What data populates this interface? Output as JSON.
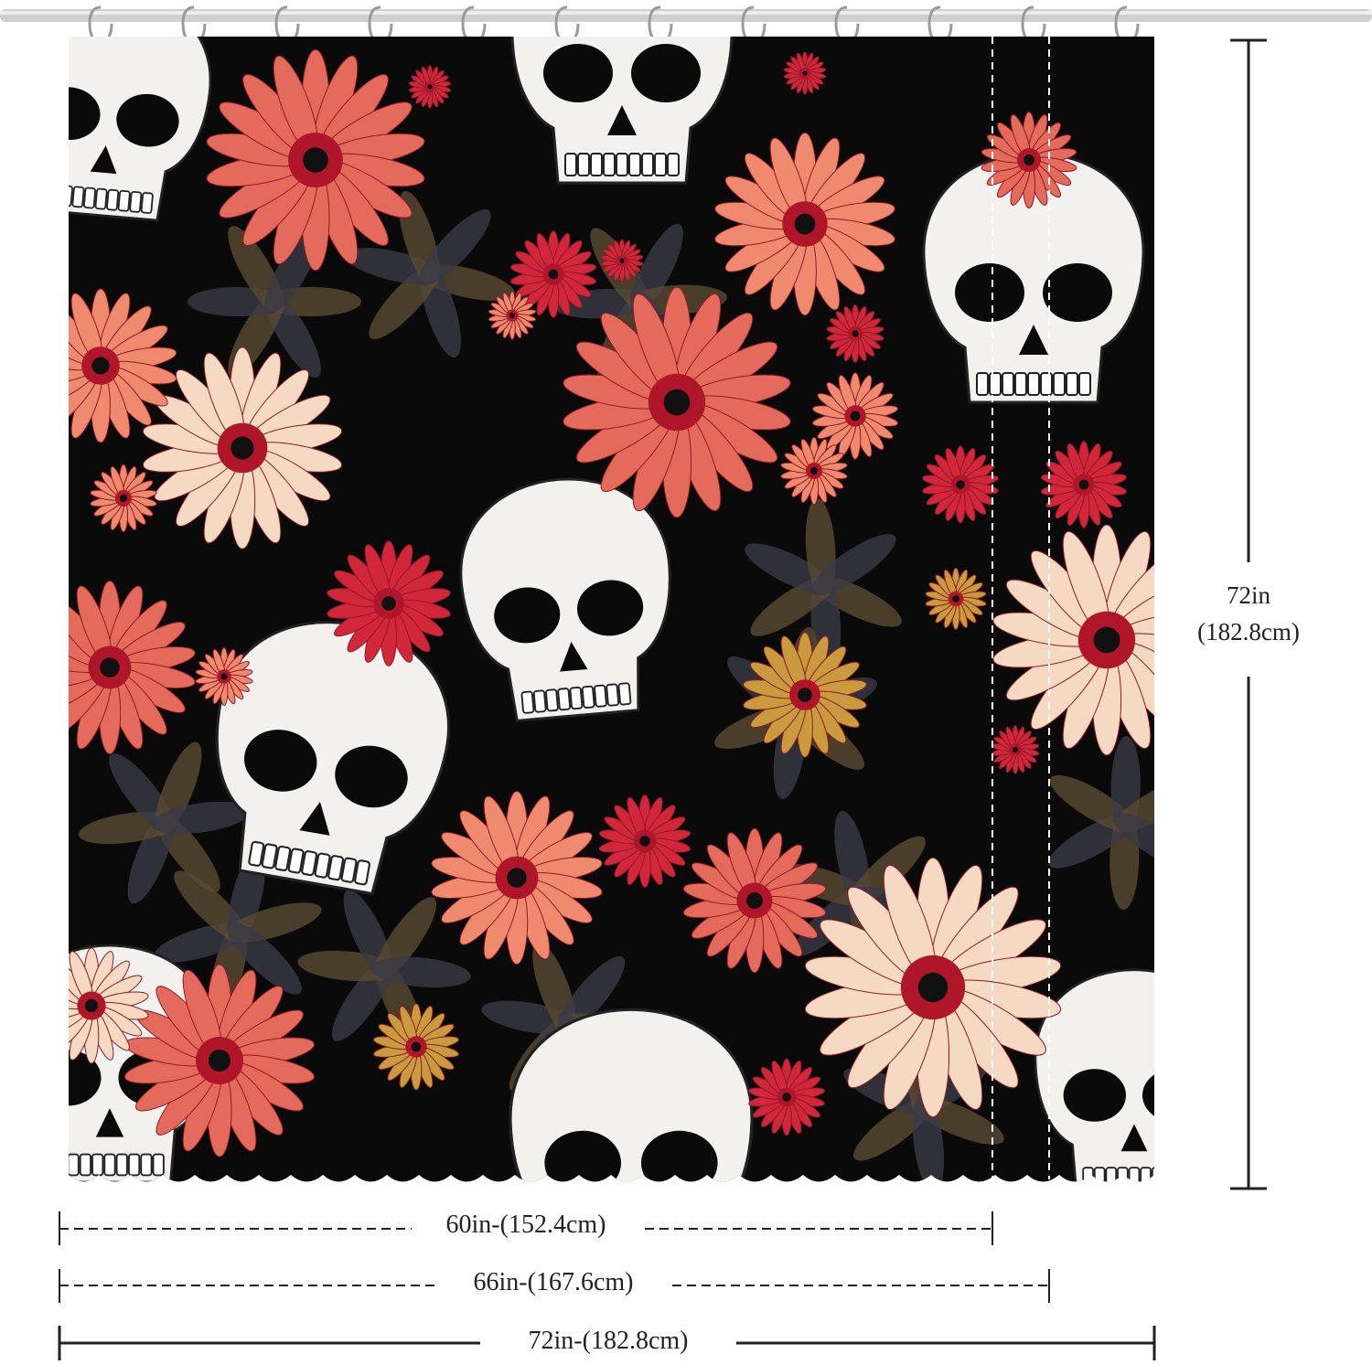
{
  "colors": {
    "curtain_background": "#0b0a0b",
    "skull": "#f3f1ee",
    "flower_coral": "#e46a5b",
    "flower_salmon": "#f08a6f",
    "flower_red": "#d2263a",
    "flower_cream": "#f5d9c2",
    "flower_gold": "#c99a3e",
    "leaf_dark": "#3a3a46",
    "rod": "#c8c8c8",
    "dimension_line": "#222222"
  },
  "product": {
    "pattern": "skulls-and-daisies",
    "hooks_visible": 12
  },
  "dimensions": {
    "height_label_line1": "72in",
    "height_label_line2": "(182.8cm)",
    "width_60_label": "60in-(152.4cm)",
    "width_66_label": "66in-(167.6cm)",
    "width_72_label": "72in-(182.8cm)"
  }
}
